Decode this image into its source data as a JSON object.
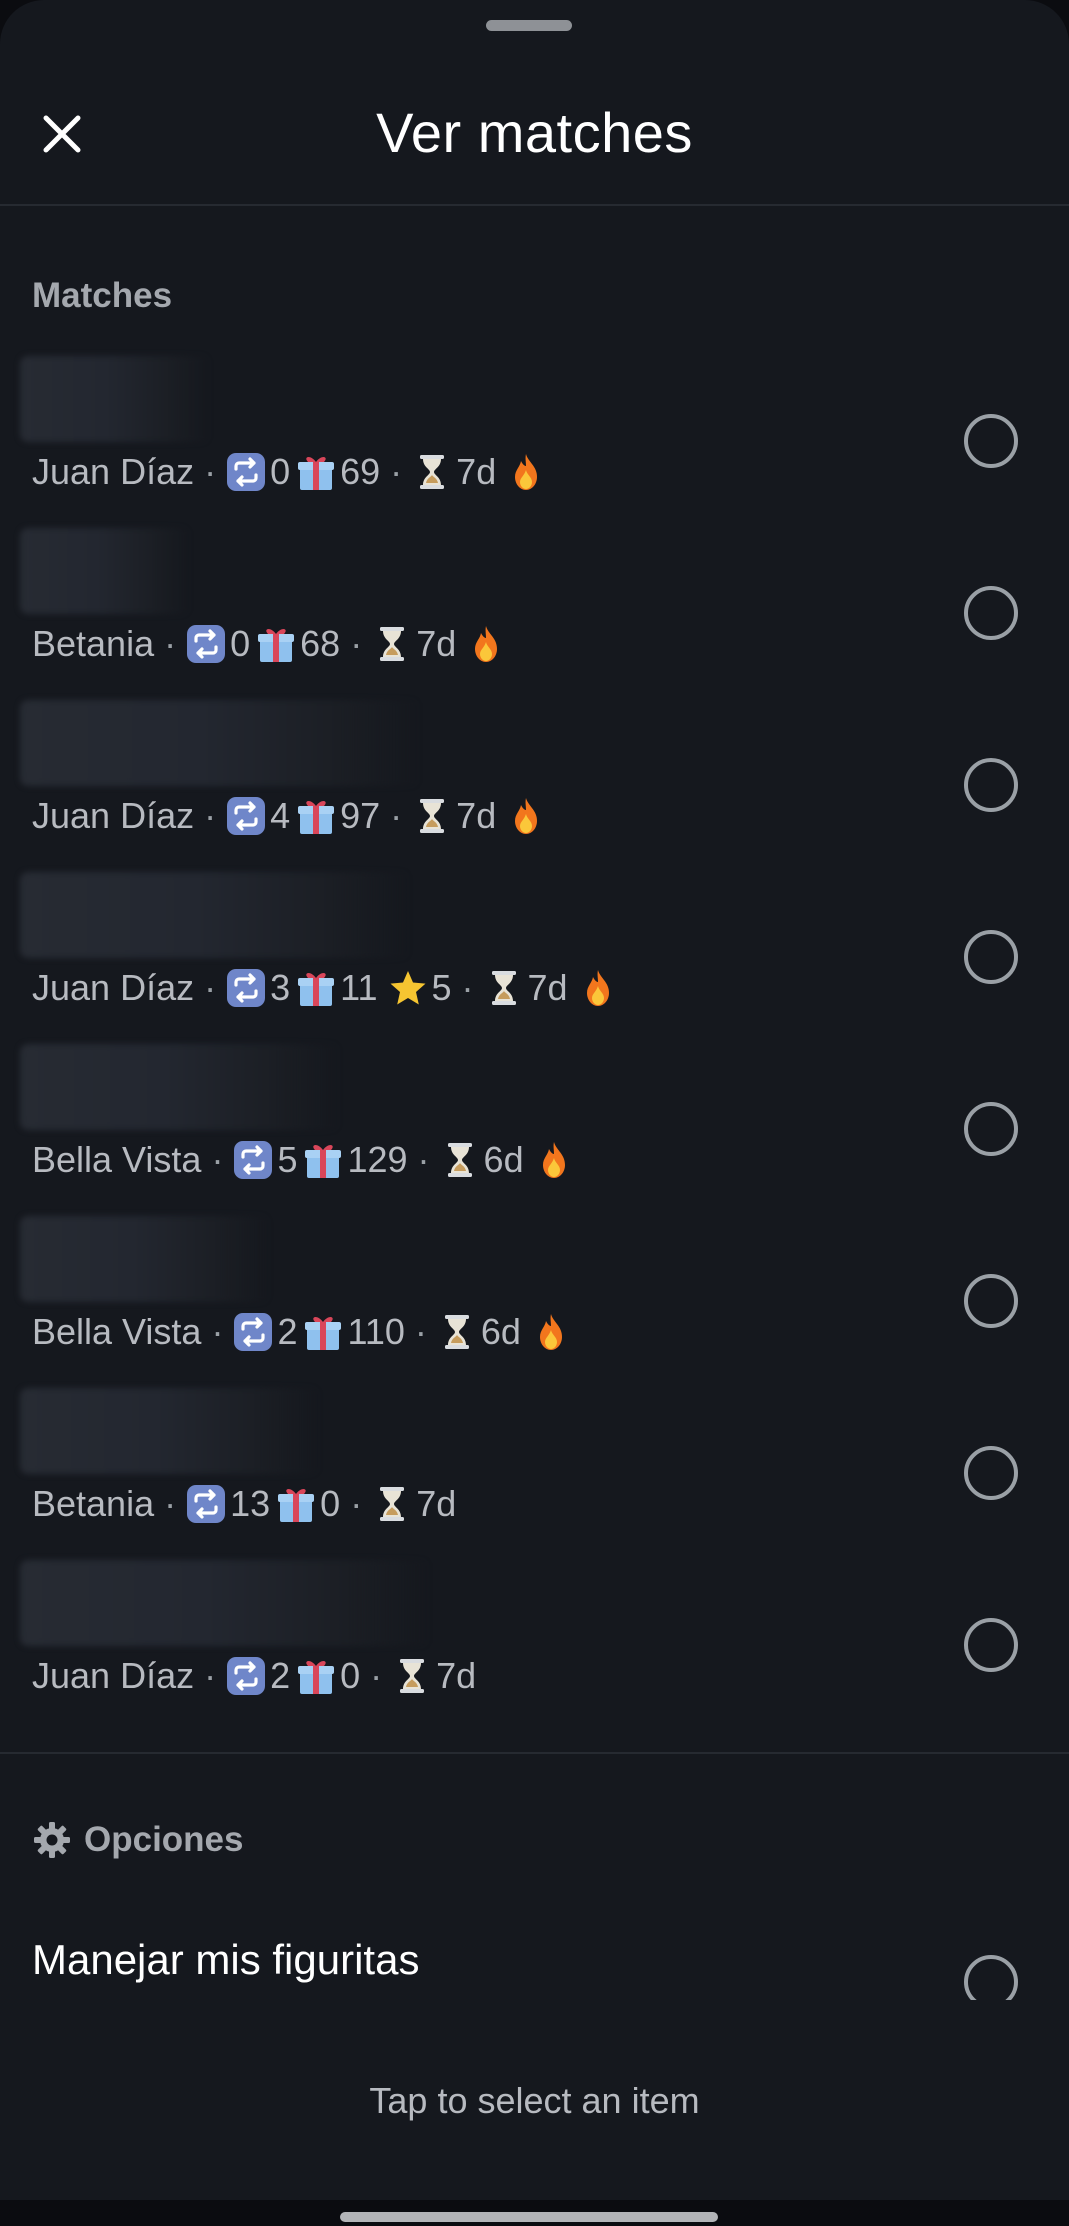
{
  "header": {
    "title": "Ver matches"
  },
  "matches_section": {
    "label": "Matches"
  },
  "matches": [
    {
      "location": "Juan Díaz",
      "swaps": "0",
      "gifts": "69",
      "stars": "",
      "time": "7d",
      "hot": true
    },
    {
      "location": "Betania",
      "swaps": "0",
      "gifts": "68",
      "stars": "",
      "time": "7d",
      "hot": true
    },
    {
      "location": "Juan Díaz",
      "swaps": "4",
      "gifts": "97",
      "stars": "",
      "time": "7d",
      "hot": true
    },
    {
      "location": "Juan Díaz",
      "swaps": "3",
      "gifts": "11",
      "stars": "5",
      "time": "7d",
      "hot": true
    },
    {
      "location": "Bella Vista",
      "swaps": "5",
      "gifts": "129",
      "stars": "",
      "time": "6d",
      "hot": true
    },
    {
      "location": "Bella Vista",
      "swaps": "2",
      "gifts": "110",
      "stars": "",
      "time": "6d",
      "hot": true
    },
    {
      "location": "Betania",
      "swaps": "13",
      "gifts": "0",
      "stars": "",
      "time": "7d",
      "hot": false
    },
    {
      "location": "Juan Díaz",
      "swaps": "2",
      "gifts": "0",
      "stars": "",
      "time": "7d",
      "hot": false
    }
  ],
  "options_section": {
    "label": "Opciones",
    "icon": "gear-icon"
  },
  "options": [
    {
      "label": "Manejar mis figuritas"
    }
  ],
  "footer": {
    "hint": "Tap to select an item"
  },
  "icons": {
    "close": "close-icon",
    "swap": "repeat-icon",
    "gift": "gift-icon",
    "star": "star-icon",
    "time": "hourglass-icon",
    "hot": "fire-icon"
  },
  "colors": {
    "sheet_bg": "#15181e",
    "text_primary": "#ffffff",
    "text_secondary": "#b7bac0",
    "radio": "#9aa0a6",
    "swap_icon": "#7b8fd6",
    "gift_icon": "#7fb3e8",
    "gift_ribbon": "#d9465a",
    "fire": "#f2761d"
  }
}
